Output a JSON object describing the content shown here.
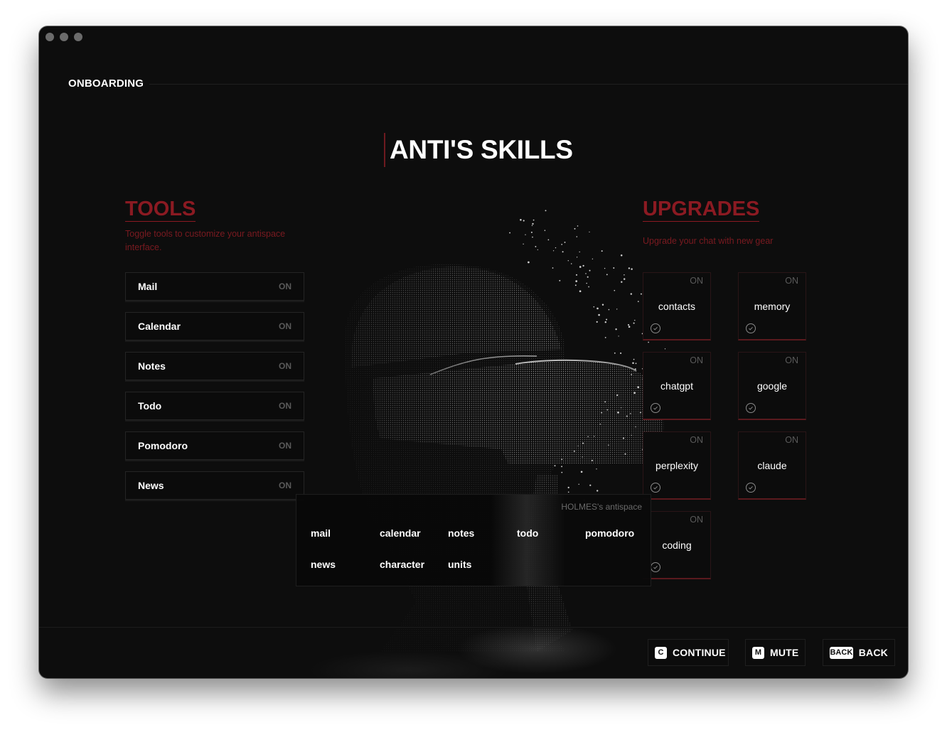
{
  "window": {
    "traffic_lights": [
      "close",
      "minimize",
      "maximize"
    ]
  },
  "header": {
    "title": "ONBOARDING"
  },
  "page": {
    "title": "ANTI'S SKILLS"
  },
  "tools": {
    "title": "TOOLS",
    "subtitle": "Toggle tools to customize your antispace interface.",
    "items": [
      {
        "label": "Mail",
        "state": "ON"
      },
      {
        "label": "Calendar",
        "state": "ON"
      },
      {
        "label": "Notes",
        "state": "ON"
      },
      {
        "label": "Todo",
        "state": "ON"
      },
      {
        "label": "Pomodoro",
        "state": "ON"
      },
      {
        "label": "News",
        "state": "ON"
      }
    ]
  },
  "upgrades": {
    "title": "UPGRADES",
    "subtitle": "Upgrade your chat with new gear",
    "items": [
      {
        "label": "contacts",
        "state": "ON",
        "icon": "check-circle-icon"
      },
      {
        "label": "memory",
        "state": "ON",
        "icon": "check-circle-icon"
      },
      {
        "label": "chatgpt",
        "state": "ON",
        "icon": "check-circle-icon"
      },
      {
        "label": "google",
        "state": "ON",
        "icon": "check-circle-icon"
      },
      {
        "label": "perplexity",
        "state": "ON",
        "icon": "check-circle-icon"
      },
      {
        "label": "claude",
        "state": "ON",
        "icon": "check-circle-icon"
      },
      {
        "label": "coding",
        "state": "ON",
        "icon": "check-circle-icon"
      }
    ]
  },
  "antispace": {
    "owner": "HOLMES's antispace",
    "items": [
      "mail",
      "calendar",
      "notes",
      "todo",
      "pomodoro",
      "news",
      "character",
      "units"
    ]
  },
  "footer": {
    "continue": {
      "key": "C",
      "label": "CONTINUE"
    },
    "mute": {
      "key": "M",
      "label": "MUTE"
    },
    "back": {
      "key": "BACK",
      "label": "BACK"
    }
  },
  "colors": {
    "accent": "#8b1a22",
    "background": "#0d0d0d",
    "text": "#ffffff",
    "muted": "#5a5a5a"
  }
}
